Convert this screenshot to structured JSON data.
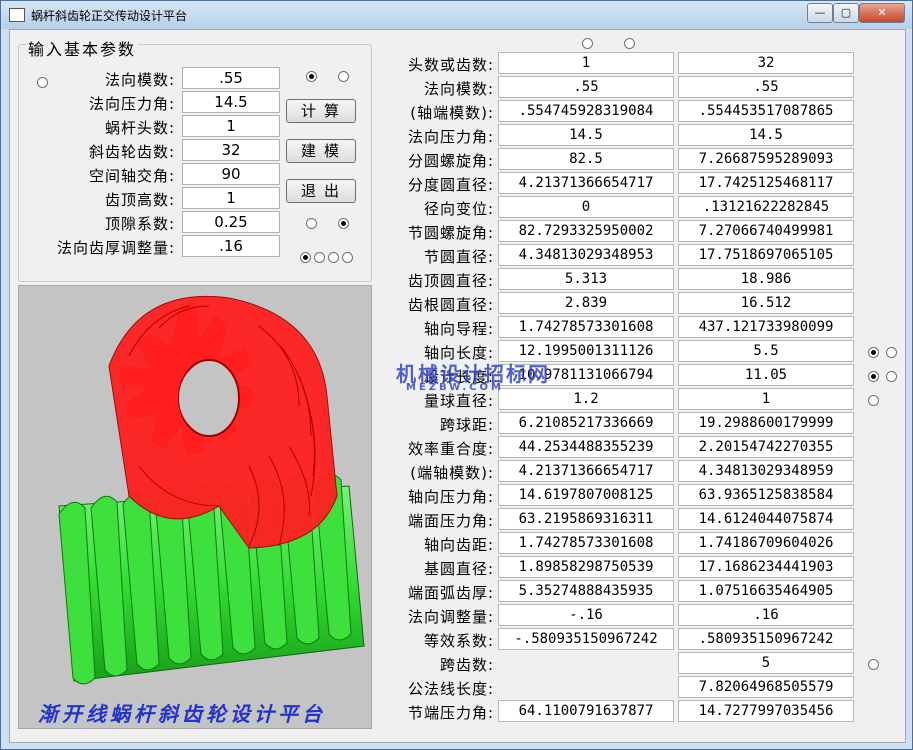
{
  "window": {
    "title": "蜗杆斜齿轮正交传动设计平台",
    "min": "—",
    "max": "▢",
    "close": "✕"
  },
  "input_group": {
    "title": "输入基本参数",
    "rows": [
      {
        "label": "法向模数:",
        "value": ".55"
      },
      {
        "label": "法向压力角:",
        "value": "14.5"
      },
      {
        "label": "蜗杆头数:",
        "value": "1"
      },
      {
        "label": "斜齿轮齿数:",
        "value": "32"
      },
      {
        "label": "空间轴交角:",
        "value": "90"
      },
      {
        "label": "齿顶高数:",
        "value": "1"
      },
      {
        "label": "顶隙系数:",
        "value": "0.25"
      },
      {
        "label": "法向齿厚调整量:",
        "value": ".16"
      }
    ],
    "buttons": {
      "calc": "计算",
      "model": "建模",
      "exit": "退出"
    }
  },
  "image": {
    "worm_color": "#33dd33",
    "gear_color": "#ff1a1a",
    "background": "#c4c4c4"
  },
  "banner": "渐开线蜗杆斜齿轮设计平台",
  "watermark": {
    "line1": "机械设计招标网",
    "line2": "MEZBW.COM"
  },
  "results": [
    {
      "label": "头数或齿数:",
      "c1": "1",
      "c2": "32"
    },
    {
      "label": "法向模数:",
      "c1": ".55",
      "c2": ".55"
    },
    {
      "label": "(轴端模数):",
      "c1": ".554745928319084",
      "c2": ".554453517087865"
    },
    {
      "label": "法向压力角:",
      "c1": "14.5",
      "c2": "14.5"
    },
    {
      "label": "分圆螺旋角:",
      "c1": "82.5",
      "c2": "7.26687595289093"
    },
    {
      "label": "分度圆直径:",
      "c1": "4.21371366654717",
      "c2": "17.7425125468117"
    },
    {
      "label": "径向变位:",
      "c1": "0",
      "c2": ".13121622282845"
    },
    {
      "label": "节圆螺旋角:",
      "c1": "82.7293325950002",
      "c2": "7.27066740499981"
    },
    {
      "label": "节圆直径:",
      "c1": "4.34813029348953",
      "c2": "17.7518697065105"
    },
    {
      "label": "齿顶圆直径:",
      "c1": "5.313",
      "c2": "18.986"
    },
    {
      "label": "齿根圆直径:",
      "c1": "2.839",
      "c2": "16.512"
    },
    {
      "label": "轴向导程:",
      "c1": "1.74278573301608",
      "c2": "437.121733980099"
    },
    {
      "label": "轴向长度:",
      "c1": "12.1995001311126",
      "c2": "5.5"
    },
    {
      "label": "设计长度:",
      "c1": "10.9781131066794",
      "c2": "11.05"
    },
    {
      "label": "量球直径:",
      "c1": "1.2",
      "c2": "1"
    },
    {
      "label": "跨球距:",
      "c1": "6.21085217336669",
      "c2": "19.2988600179999"
    },
    {
      "label": "效率重合度:",
      "c1": "44.2534488355239",
      "c2": "2.20154742270355"
    },
    {
      "label": "(端轴模数):",
      "c1": "4.21371366654717",
      "c2": "4.34813029348959"
    },
    {
      "label": "轴向压力角:",
      "c1": "14.6197807008125",
      "c2": "63.9365125838584"
    },
    {
      "label": "端面压力角:",
      "c1": "63.2195869316311",
      "c2": "14.6124044075874"
    },
    {
      "label": "轴向齿距:",
      "c1": "1.74278573301608",
      "c2": "1.74186709604026"
    },
    {
      "label": "基圆直径:",
      "c1": "1.89858298750539",
      "c2": "17.1686234441903"
    },
    {
      "label": "端面弧齿厚:",
      "c1": "5.35274888435935",
      "c2": "1.07516635464905"
    },
    {
      "label": "法向调整量:",
      "c1": "-.16",
      "c2": ".16"
    },
    {
      "label": "等效系数:",
      "c1": "-.580935150967242",
      "c2": ".580935150967242"
    },
    {
      "label": "跨齿数:",
      "c1": "",
      "c2": "5"
    },
    {
      "label": "公法线长度:",
      "c1": "",
      "c2": "7.82064968505579"
    },
    {
      "label": "节端压力角:",
      "c1": "64.1100791637877",
      "c2": "14.7277997035456"
    }
  ]
}
